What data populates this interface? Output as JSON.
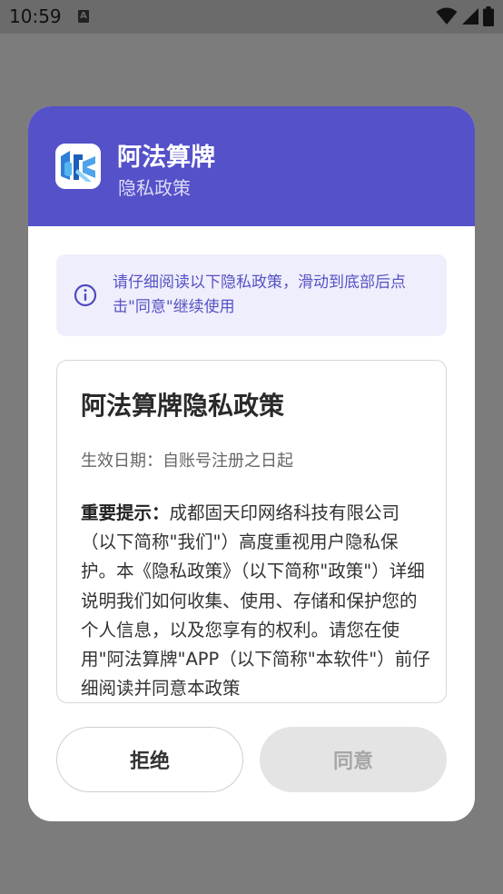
{
  "status_bar": {
    "time": "10:59",
    "notification_icon": "a-icon",
    "icons": [
      "wifi-icon",
      "signal-icon",
      "battery-icon"
    ]
  },
  "dialog": {
    "app_name": "阿法算牌",
    "subtitle": "隐私政策",
    "header_color": "#5451c9",
    "notice": {
      "icon": "info-icon",
      "text": "请仔细阅读以下隐私政策，滑动到底部后点击\"同意\"继续使用"
    },
    "policy": {
      "title": "阿法算牌隐私政策",
      "effective_date": "生效日期：自账号注册之日起",
      "important_label": "重要提示：",
      "body": "成都固天印网络科技有限公司（以下简称\"我们\"）高度重视用户隐私保护。本《隐私政策》（以下简称\"政策\"）详细说明我们如何收集、使用、存储和保护您的个人信息，以及您享有的权利。请您在使用\"阿法算牌\"APP（以下简称\"本软件\"）前仔细阅读并同意本政策"
    },
    "buttons": {
      "reject": "拒绝",
      "agree": "同意"
    }
  }
}
